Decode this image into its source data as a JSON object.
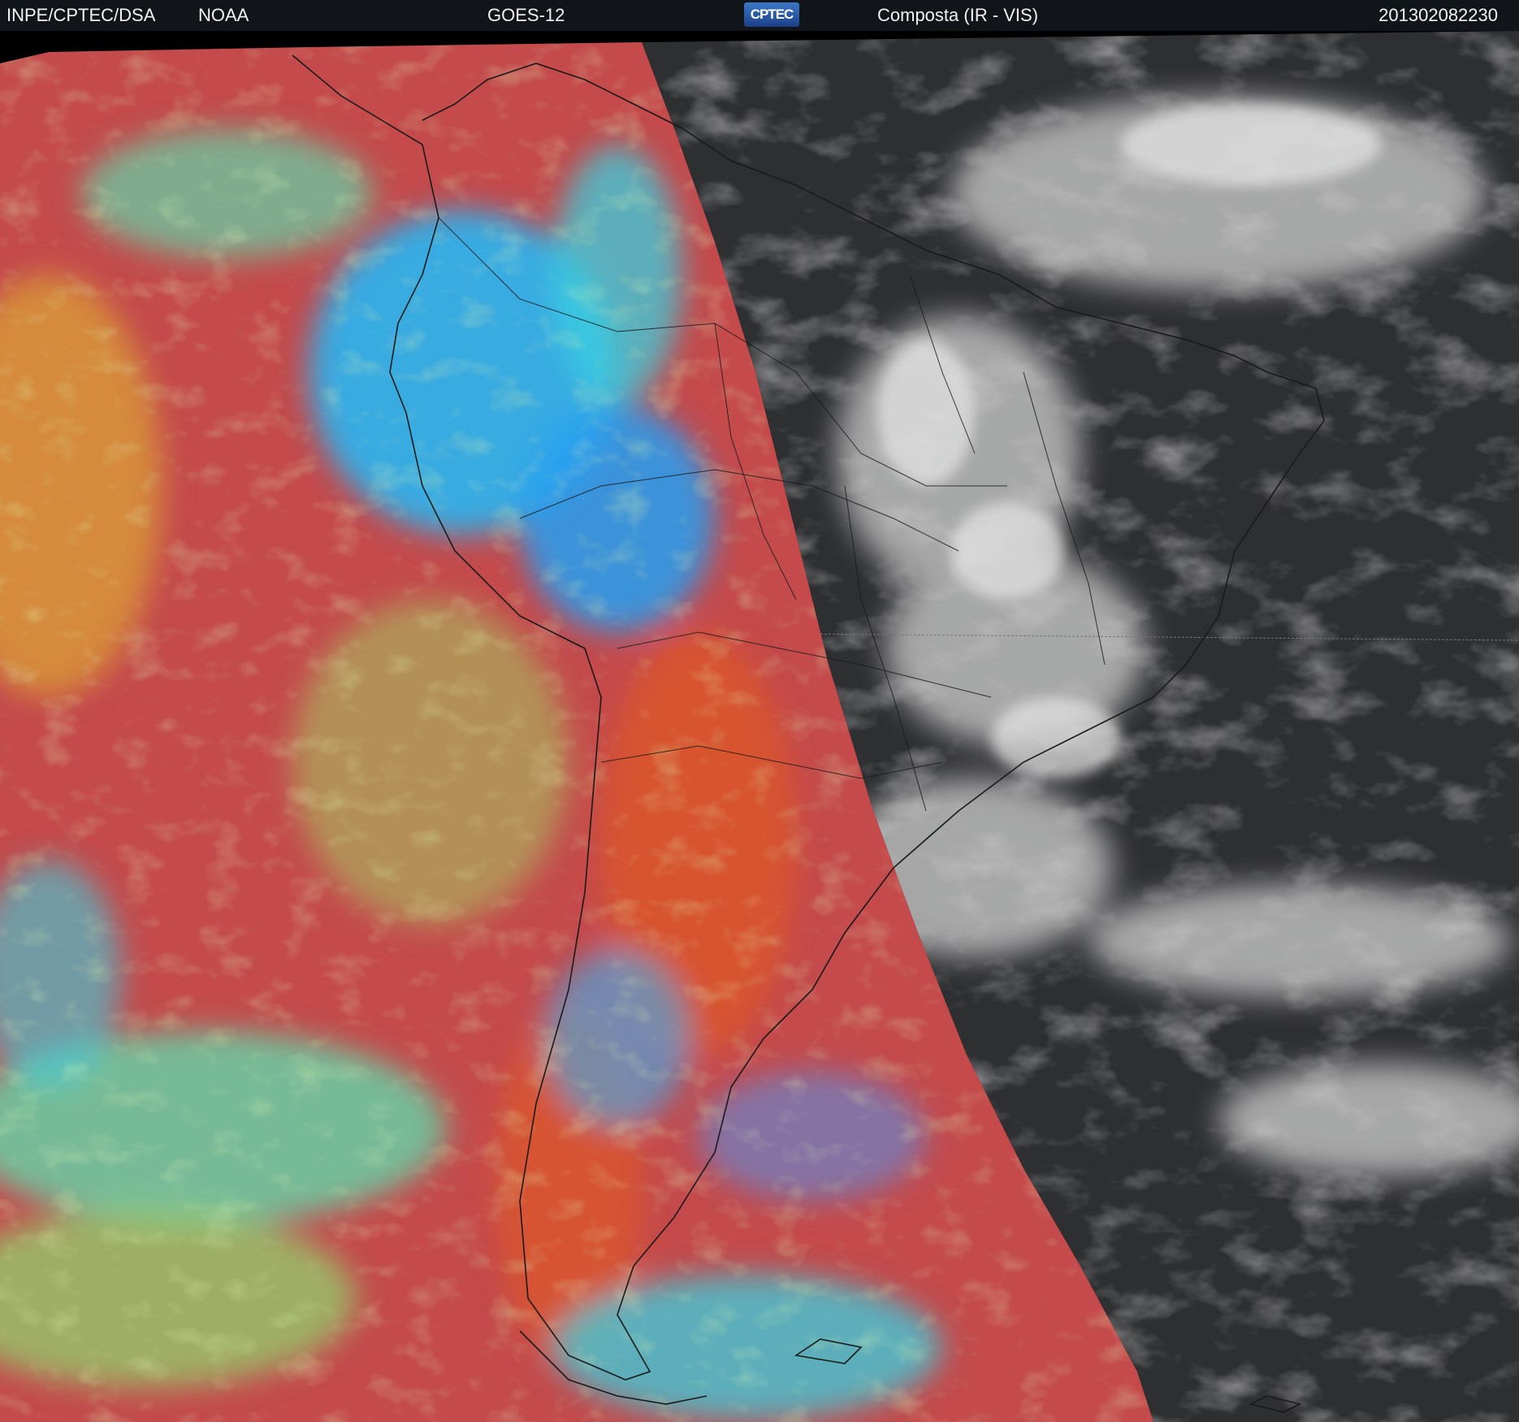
{
  "header": {
    "organization": "INPE/CPTEC/DSA",
    "agency": "NOAA",
    "satellite": "GOES-12",
    "logo_text": "CPTEC",
    "product": "Composta (IR - VIS)",
    "timestamp": "201302082230"
  },
  "colors": {
    "header_background": "#111418",
    "header_text": "#f2f2f2",
    "ir_clear_sky": "#c44a4c",
    "ir_land_hot": "#d9552e",
    "ir_cold_cloud": "#27b6f2",
    "ir_mid_cloud": "#5ee0b0",
    "ir_low_cloud": "#a8d860",
    "vis_background": "#2e2f31",
    "vis_cloud": "#d6d6d6",
    "coastline": "#1a1a1a"
  }
}
